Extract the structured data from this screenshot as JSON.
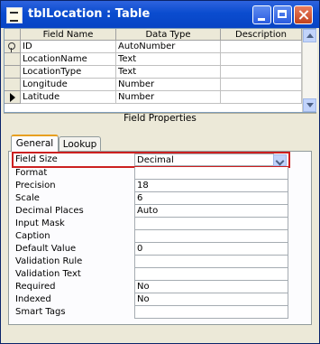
{
  "window": {
    "title": "tblLocation : Table"
  },
  "grid": {
    "headers": {
      "field_name": "Field Name",
      "data_type": "Data Type",
      "description": "Description"
    },
    "rows": [
      {
        "field": "ID",
        "type": "AutoNumber",
        "primary_key": true,
        "current": false
      },
      {
        "field": "LocationName",
        "type": "Text",
        "primary_key": false,
        "current": false
      },
      {
        "field": "LocationType",
        "type": "Text",
        "primary_key": false,
        "current": false
      },
      {
        "field": "Longitude",
        "type": "Number",
        "primary_key": false,
        "current": false
      },
      {
        "field": "Latitude",
        "type": "Number",
        "primary_key": false,
        "current": true
      }
    ]
  },
  "field_properties": {
    "title": "Field Properties",
    "tabs": [
      "General",
      "Lookup"
    ],
    "active_tab": "General",
    "properties": [
      {
        "label": "Field Size",
        "value": "Decimal"
      },
      {
        "label": "Format",
        "value": ""
      },
      {
        "label": "Precision",
        "value": "18"
      },
      {
        "label": "Scale",
        "value": "6"
      },
      {
        "label": "Decimal Places",
        "value": "Auto"
      },
      {
        "label": "Input Mask",
        "value": ""
      },
      {
        "label": "Caption",
        "value": ""
      },
      {
        "label": "Default Value",
        "value": "0"
      },
      {
        "label": "Validation Rule",
        "value": ""
      },
      {
        "label": "Validation Text",
        "value": ""
      },
      {
        "label": "Required",
        "value": "No"
      },
      {
        "label": "Indexed",
        "value": "No"
      },
      {
        "label": "Smart Tags",
        "value": ""
      }
    ]
  },
  "colors": {
    "titlebar": "#0a4ccf",
    "highlight": "#cc2020",
    "tab_accent": "#e8a020"
  }
}
